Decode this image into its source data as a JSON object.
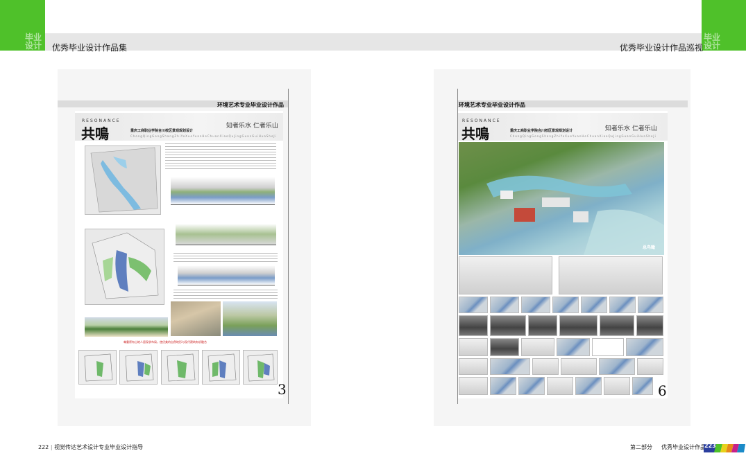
{
  "header": {
    "left_title": "优秀毕业设计作品集",
    "right_title": "优秀毕业设计作品巡视",
    "left_ghost": [
      "毕业",
      "设计"
    ],
    "right_ghost": [
      "毕业",
      "设计"
    ],
    "accent_color": "#4fc12a"
  },
  "left_board": {
    "band_title": "环境艺术专业毕业设计作品",
    "resonance": "RESONANCE",
    "title": "共鳴",
    "subtitle": "重庆工商职业学院合川校区景观规划设计",
    "pinyin": "ChongQingGongShangZhiYeXueYuanHeChuanXiaoQuJingGuanGuiHuaSheJi",
    "motto": "知者乐水  仁者乐山",
    "page_number": "3",
    "red_caption": "尊重原有山地人居现状布局，使优美的自然地形与现代建筑有机融合"
  },
  "right_board": {
    "band_title": "环境艺术专业毕业设计作品",
    "resonance": "RESONANCE",
    "title": "共鳴",
    "subtitle": "重庆工商职业学院合川校区景观规划设计",
    "pinyin": "ChongQingGongShangZhiYeXueYuanHeChuanXiaoQuJingGuanGuiHuaSheJi",
    "motto": "知者乐水  仁者乐山",
    "aerial_label": "总鸟瞰",
    "page_number": "6"
  },
  "footer": {
    "left_page": "222",
    "left_text": "视觉传达艺术设计专业毕业设计指导",
    "right_section": "第二部分",
    "right_text": "优秀毕业设计作品巡视",
    "right_page": "223",
    "stripe_colors": [
      "#2b3f9e",
      "#4fc12a",
      "#e8d21a",
      "#e8891a",
      "#c8218a",
      "#1a8ac8"
    ]
  }
}
